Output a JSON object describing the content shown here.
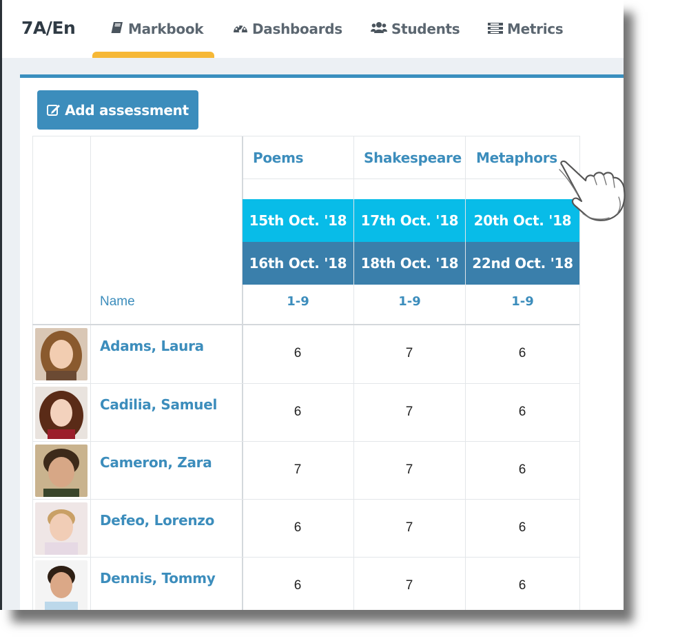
{
  "app": {
    "title": "7A/En"
  },
  "nav": {
    "tabs": [
      {
        "label": "Markbook",
        "icon": "book-icon",
        "active": true
      },
      {
        "label": "Dashboards",
        "icon": "dashboard-icon"
      },
      {
        "label": "Students",
        "icon": "users-icon"
      },
      {
        "label": "Metrics",
        "icon": "list-icon"
      }
    ]
  },
  "toolbar": {
    "add_label": "Add assessment",
    "add_icon": "edit-icon"
  },
  "table": {
    "name_header": "Name",
    "assessments": [
      {
        "title": "Poems",
        "date1": "15th Oct. '18",
        "date2": "16th Oct. '18",
        "scale": "1-9"
      },
      {
        "title": "Shakespeare",
        "date1": "17th Oct. '18",
        "date2": "18th Oct. '18",
        "scale": "1-9"
      },
      {
        "title": "Metaphors",
        "date1": "20th Oct. '18",
        "date2": "22nd Oct. '18",
        "scale": "1-9"
      }
    ],
    "rows": [
      {
        "name": "Adams, Laura",
        "marks": [
          "6",
          "7",
          "6"
        ]
      },
      {
        "name": "Cadilia, Samuel",
        "marks": [
          "6",
          "7",
          "6"
        ]
      },
      {
        "name": "Cameron, Zara",
        "marks": [
          "7",
          "7",
          "6"
        ]
      },
      {
        "name": "Defeo, Lorenzo",
        "marks": [
          "6",
          "7",
          "6"
        ]
      },
      {
        "name": "Dennis, Tommy",
        "marks": [
          "6",
          "7",
          "6"
        ]
      }
    ]
  },
  "colors": {
    "primary": "#3c8dbc",
    "accent_tab": "#f6b836",
    "date_cyan": "#08bce8",
    "date_dark": "#3a7fab"
  }
}
